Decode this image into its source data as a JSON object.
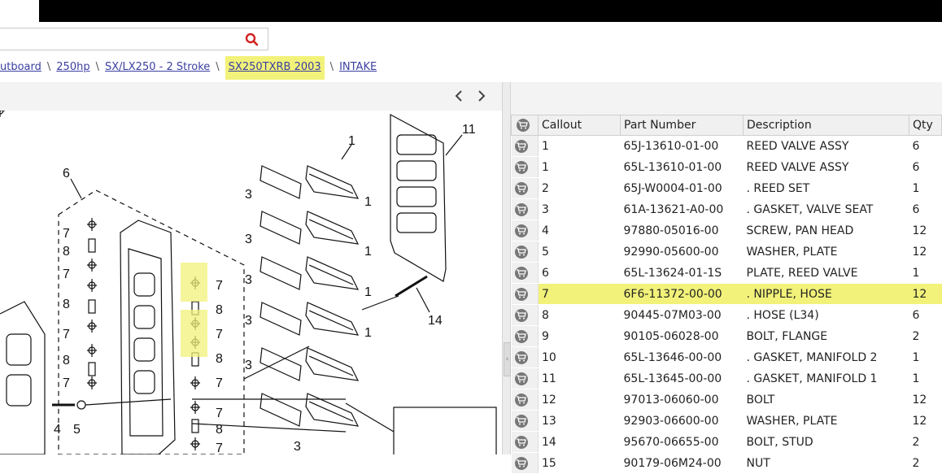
{
  "breadcrumb": {
    "items": [
      "utboard",
      "250hp",
      "SX/LX250 - 2 Stroke",
      "SX250TXRB 2003",
      "INTAKE"
    ],
    "separator": "\\",
    "highlighted_index": 3
  },
  "search": {
    "value": "",
    "icon": "search-icon"
  },
  "diagram": {
    "labels": [
      "1",
      "1",
      "1",
      "1",
      "1",
      "1",
      "2",
      "3",
      "3",
      "3",
      "3",
      "3",
      "3",
      "4",
      "5",
      "6",
      "7",
      "7",
      "7",
      "7",
      "7",
      "7",
      "7",
      "7",
      "7",
      "7",
      "8",
      "8",
      "8",
      "8",
      "8",
      "8",
      "11",
      "14"
    ]
  },
  "table": {
    "headers": [
      "Callout",
      "Part Number",
      "Description",
      "Qty"
    ],
    "highlight_color": "#f2f27a",
    "rows": [
      {
        "callout": "1",
        "part": "65J-13610-01-00",
        "desc": "REED VALVE ASSY",
        "qty": "6"
      },
      {
        "callout": "1",
        "part": "65L-13610-01-00",
        "desc": "REED VALVE ASSY",
        "qty": "6"
      },
      {
        "callout": "2",
        "part": "65J-W0004-01-00",
        "desc": ". REED SET",
        "qty": "1"
      },
      {
        "callout": "3",
        "part": "61A-13621-A0-00",
        "desc": ". GASKET, VALVE SEAT",
        "qty": "6"
      },
      {
        "callout": "4",
        "part": "97880-05016-00",
        "desc": "SCREW, PAN HEAD",
        "qty": "12"
      },
      {
        "callout": "5",
        "part": "92990-05600-00",
        "desc": "WASHER, PLATE",
        "qty": "12"
      },
      {
        "callout": "6",
        "part": "65L-13624-01-1S",
        "desc": "PLATE, REED VALVE",
        "qty": "1"
      },
      {
        "callout": "7",
        "part": "6F6-11372-00-00",
        "desc": ". NIPPLE, HOSE",
        "qty": "12",
        "highlight": true
      },
      {
        "callout": "8",
        "part": "90445-07M03-00",
        "desc": ". HOSE (L34)",
        "qty": "6"
      },
      {
        "callout": "9",
        "part": "90105-06028-00",
        "desc": "BOLT, FLANGE",
        "qty": "2"
      },
      {
        "callout": "10",
        "part": "65L-13646-00-00",
        "desc": ". GASKET, MANIFOLD 2",
        "qty": "1"
      },
      {
        "callout": "11",
        "part": "65L-13645-00-00",
        "desc": ". GASKET, MANIFOLD 1",
        "qty": "1"
      },
      {
        "callout": "12",
        "part": "97013-06060-00",
        "desc": "BOLT",
        "qty": "12"
      },
      {
        "callout": "13",
        "part": "92903-06600-00",
        "desc": "WASHER, PLATE",
        "qty": "12"
      },
      {
        "callout": "14",
        "part": "95670-06655-00",
        "desc": "BOLT, STUD",
        "qty": "2"
      },
      {
        "callout": "15",
        "part": "90179-06M24-00",
        "desc": "NUT",
        "qty": "2"
      }
    ]
  },
  "icons": {
    "prev": "chevron-left-icon",
    "next": "chevron-right-icon",
    "cart": "cart-icon"
  }
}
